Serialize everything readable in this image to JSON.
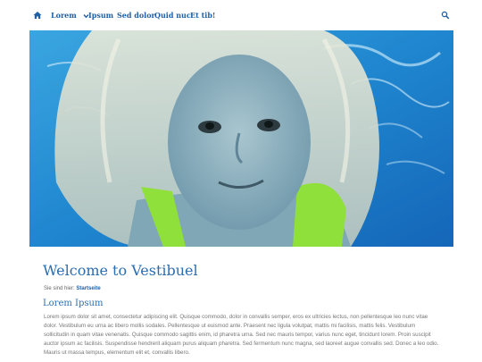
{
  "nav": {
    "home_icon": "home-icon",
    "items": [
      {
        "label": "Lorem",
        "has_dropdown": true
      },
      {
        "label": "Ipsum"
      },
      {
        "label": "Sed dolor"
      },
      {
        "label": "Quid nuc"
      },
      {
        "label": "Et tib!"
      }
    ],
    "search_icon": "search-icon"
  },
  "hero": {
    "alt_icon": "photo-girl-underwater"
  },
  "page": {
    "title": "Welcome to Vestibuel",
    "breadcrumb_prefix": "Sie sind hier:",
    "breadcrumb_link": "Startseite",
    "subtitle": "Lorem Ipsum",
    "body": "Lorem ipsum dolor sit amet, consectetur adipiscing elit. Quisque commodo, dolor in convallis semper, eros ex ultricies lectus, non pellentesque leo nunc vitae dolor. Vestibulum eu urna ac libero mollis sodales. Pellentesque ut euismod ante. Praesent nec ligula volutpat, mattis mi facilisis, mattis felis. Vestibulum sollicitudin in quam vitae venenatis. Quisque commodo sagittis enim, id pharetra urna. Sed nec mauris tempor, varius nunc eget, tincidunt lorem. Proin suscipit auctor ipsum ac facilisis. Suspendisse hendrerit aliquam purus aliquam pharetra. Sed fermentum nunc magna, sed laoreet augue convallis sed. Donec a leo odio. Mauris ut massa tempus, elementum elit et, convallis libero."
  },
  "colors": {
    "accent": "#1f5fa6",
    "title": "#2a6db0",
    "water": "#2a8fd0",
    "swimsuit": "#8fe03a"
  }
}
